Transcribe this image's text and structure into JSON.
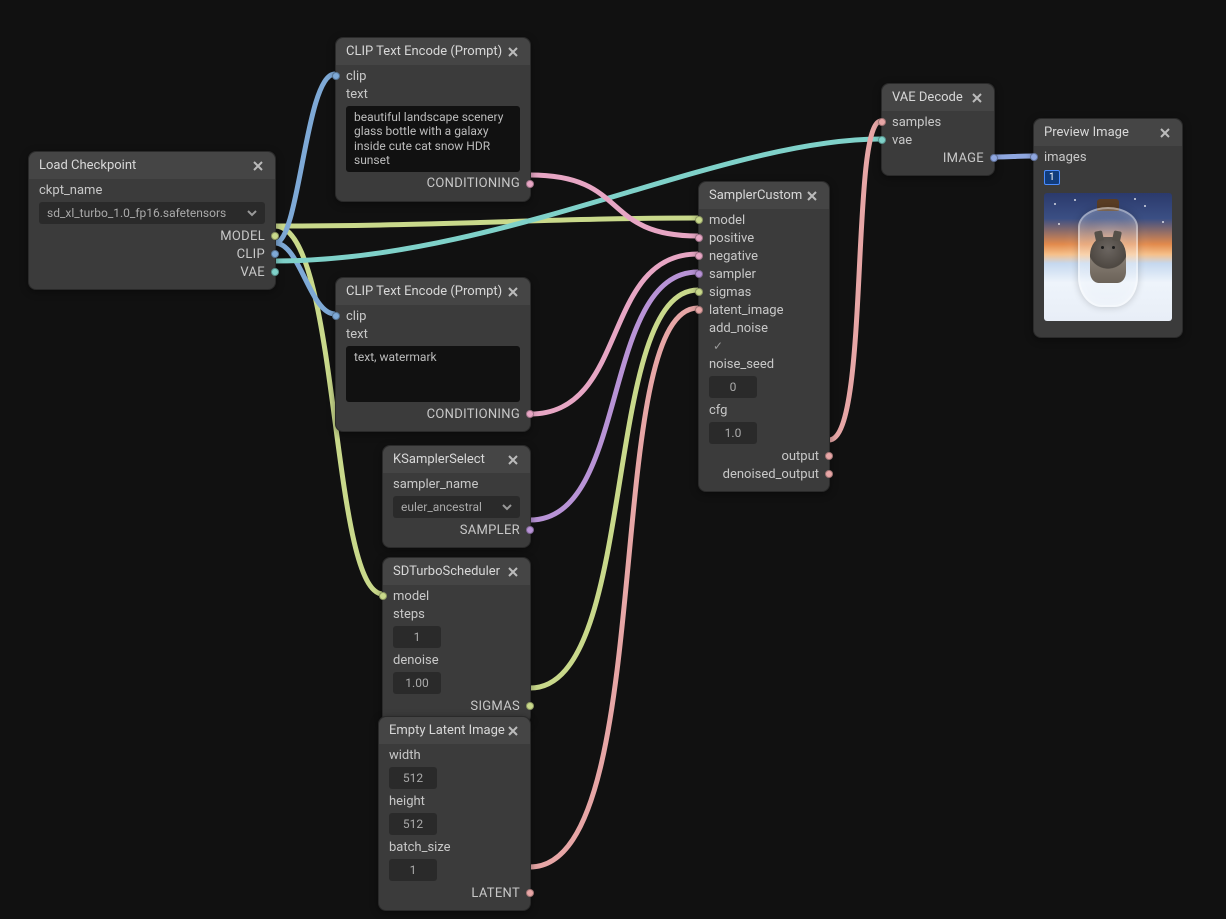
{
  "nodes": {
    "load_checkpoint": {
      "title": "Load Checkpoint",
      "inputs": {
        "ckpt_name": "ckpt_name"
      },
      "widget": "sd_xl_turbo_1.0_fp16.safetensors",
      "outputs": {
        "model": "MODEL",
        "clip": "CLIP",
        "vae": "VAE"
      }
    },
    "clip_pos": {
      "title": "CLIP Text Encode (Prompt)",
      "inputs": {
        "clip": "clip",
        "text": "text"
      },
      "prompt": "beautiful landscape scenery glass bottle with a galaxy inside cute cat snow HDR sunset",
      "outputs": {
        "conditioning": "CONDITIONING"
      }
    },
    "clip_neg": {
      "title": "CLIP Text Encode (Prompt)",
      "inputs": {
        "clip": "clip",
        "text": "text"
      },
      "prompt": "text, watermark",
      "outputs": {
        "conditioning": "CONDITIONING"
      }
    },
    "ksampler_select": {
      "title": "KSamplerSelect",
      "inputs": {
        "sampler_name": "sampler_name"
      },
      "value": "euler_ancestral",
      "outputs": {
        "sampler": "SAMPLER"
      }
    },
    "sd_turbo": {
      "title": "SDTurboScheduler",
      "inputs": {
        "model": "model",
        "steps": "steps",
        "denoise": "denoise"
      },
      "steps": "1",
      "denoise": "1.00",
      "outputs": {
        "sigmas": "SIGMAS"
      }
    },
    "empty_latent": {
      "title": "Empty Latent Image",
      "inputs": {
        "width": "width",
        "height": "height",
        "batch_size": "batch_size"
      },
      "width": "512",
      "height": "512",
      "batch_size": "1",
      "outputs": {
        "latent": "LATENT"
      }
    },
    "sampler": {
      "title": "SamplerCustom",
      "inputs": {
        "model": "model",
        "positive": "positive",
        "negative": "negative",
        "sampler": "sampler",
        "sigmas": "sigmas",
        "latent_image": "latent_image",
        "add_noise": "add_noise",
        "noise_seed": "noise_seed",
        "cfg": "cfg"
      },
      "noise_seed": "0",
      "cfg": "1.0",
      "outputs": {
        "output": "output",
        "denoised_output": "denoised_output"
      }
    },
    "vae_decode": {
      "title": "VAE Decode",
      "inputs": {
        "samples": "samples",
        "vae": "vae"
      },
      "outputs": {
        "image": "IMAGE"
      }
    },
    "preview": {
      "title": "Preview Image",
      "inputs": {
        "images": "images"
      },
      "badge": "1"
    }
  },
  "colors": {
    "model": "#c9d98b",
    "clip": "#7ea9d6",
    "vae": "#7fd1c9",
    "conditioning_pos": "#e7a6c4",
    "conditioning_neg": "#e7a6c4",
    "sampler": "#b893d6",
    "sigmas": "#c9d98b",
    "latent": "#e7a6a6",
    "image": "#8fa7e0"
  }
}
